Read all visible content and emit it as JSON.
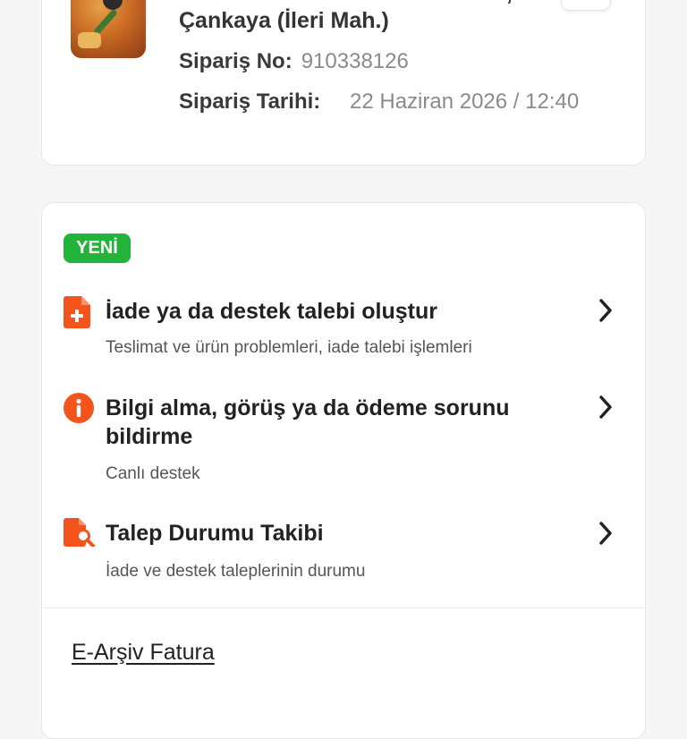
{
  "order": {
    "restaurant_name": "Domates Pide & Pizza & Waffle, Çankaya (İleri Mah.)",
    "order_no_label": "Sipariş No:",
    "order_no": "910338126",
    "order_date_label": "Sipariş Tarihi:",
    "order_date": "22 Haziran 2026 / 12:40"
  },
  "support": {
    "badge": "YENİ",
    "items": [
      {
        "title": "İade ya da destek talebi oluştur",
        "subtitle": "Teslimat ve ürün problemleri, iade talebi işlemleri"
      },
      {
        "title": "Bilgi alma, görüş ya da ödeme sorunu bildirme",
        "subtitle": "Canlı destek"
      },
      {
        "title": "Talep Durumu Takibi",
        "subtitle": "İade ve destek taleplerinin durumu"
      }
    ],
    "e_archive": "E-Arşiv Fatura"
  },
  "colors": {
    "accent": "#f2541b",
    "badge_green": "#22b43a",
    "text_dark": "#222222",
    "text_muted": "#8a8a8a"
  },
  "icons": [
    "pizza-thumbnail",
    "chevron-right-icon",
    "document-plus-icon",
    "info-circle-icon",
    "document-search-icon"
  ]
}
